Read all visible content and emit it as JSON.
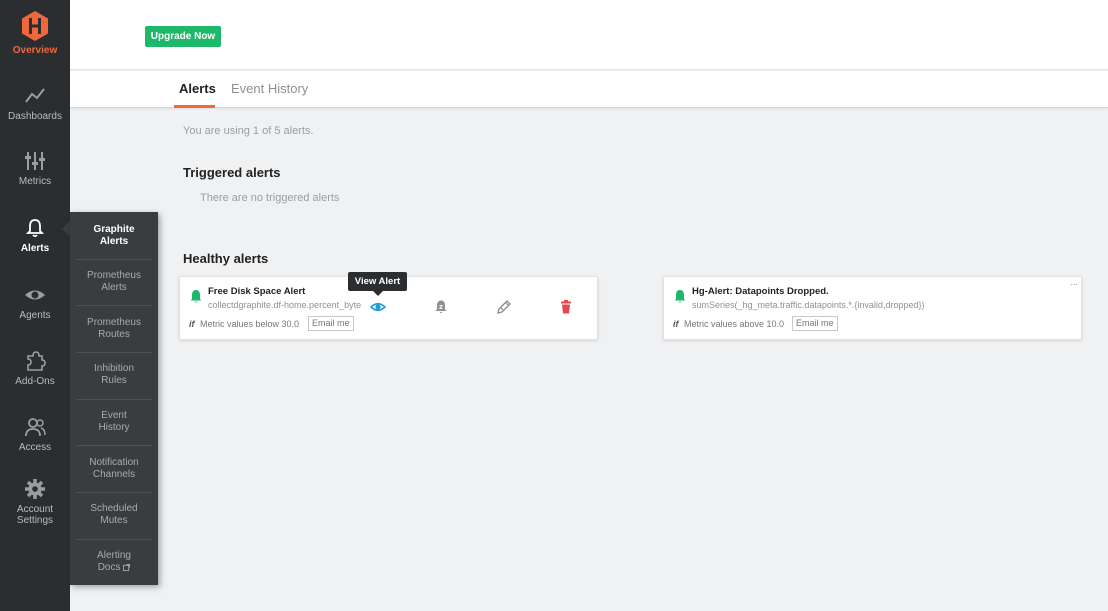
{
  "nav": {
    "overview": "Overview",
    "dashboards": "Dashboards",
    "metrics": "Metrics",
    "alerts": "Alerts",
    "agents": "Agents",
    "addons": "Add-Ons",
    "access": "Access",
    "account_settings_1": "Account",
    "account_settings_2": "Settings"
  },
  "submenu": [
    {
      "l1": "Graphite",
      "l2": "Alerts"
    },
    {
      "l1": "Prometheus",
      "l2": "Alerts"
    },
    {
      "l1": "Prometheus",
      "l2": "Routes"
    },
    {
      "l1": "Inhibition",
      "l2": "Rules"
    },
    {
      "l1": "Event",
      "l2": "History"
    },
    {
      "l1": "Notification",
      "l2": "Channels"
    },
    {
      "l1": "Scheduled",
      "l2": "Mutes"
    },
    {
      "l1": "Alerting",
      "l2": "Docs"
    }
  ],
  "header": {
    "upgrade_label": "Upgrade Now"
  },
  "tabs": {
    "alerts": "Alerts",
    "event_history": "Event History"
  },
  "usage_text": "You are using 1 of 5 alerts.",
  "triggered": {
    "title": "Triggered alerts",
    "empty": "There are no triggered alerts"
  },
  "healthy": {
    "title": "Healthy alerts",
    "cards": [
      {
        "name": "Free Disk Space Alert",
        "query": "collectdgraphite.df-home.percent_byte",
        "cond_if": "if",
        "condition": "Metric values below 30.0",
        "email": "Email me"
      },
      {
        "name": "Hg-Alert: Datapoints Dropped.",
        "query": "sumSeries(_hg_meta.traffic.datapoints.*.{invalid,dropped})",
        "cond_if": "if",
        "condition": "Metric values above 10.0",
        "email": "Email me",
        "more": "..."
      }
    ]
  },
  "tooltip": "View Alert",
  "colors": {
    "accent": "#f0673b",
    "healthy": "#1db86a",
    "view": "#1e9ad6",
    "delete": "#e8474e"
  }
}
